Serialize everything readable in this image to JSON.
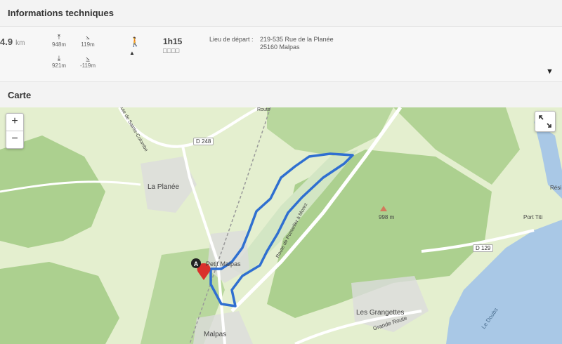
{
  "tech": {
    "title": "Informations techniques",
    "distance_value": "4.9",
    "distance_unit": "km",
    "alt_max": "948m",
    "alt_min": "921m",
    "elev_gain": "119m",
    "elev_loss": "-119m",
    "duration": "1h15",
    "difficulty": "□□□□",
    "departure_label": "Lieu de départ :",
    "departure_line1": "219-535 Rue de la Planée",
    "departure_line2": "25160 Malpas"
  },
  "map": {
    "title": "Carte",
    "zoom_in": "+",
    "zoom_out": "−",
    "start_marker": "A",
    "labels": {
      "la_planee": "La Planée",
      "petit_malpas": "Petit Malpas",
      "malpas": "Malpas",
      "les_grangettes": "Les Grangettes",
      "grande_route": "Grande Route",
      "port_titi": "Port Titi",
      "summit": "998 m",
      "route_pontarlier": "Route de Pontarlier à Morez",
      "le_doubs": "Le Doubs",
      "route_sainte": "Route de Sainte-Colombe",
      "route_top": "Route",
      "resi": "Rési"
    },
    "road_badges": {
      "d248": "D 248",
      "d129": "D 129"
    },
    "colors": {
      "track": "#2f6fd0",
      "lake": "#a9c8e6",
      "forest": "#a9cf8e",
      "meadow": "#e3efcf"
    }
  }
}
